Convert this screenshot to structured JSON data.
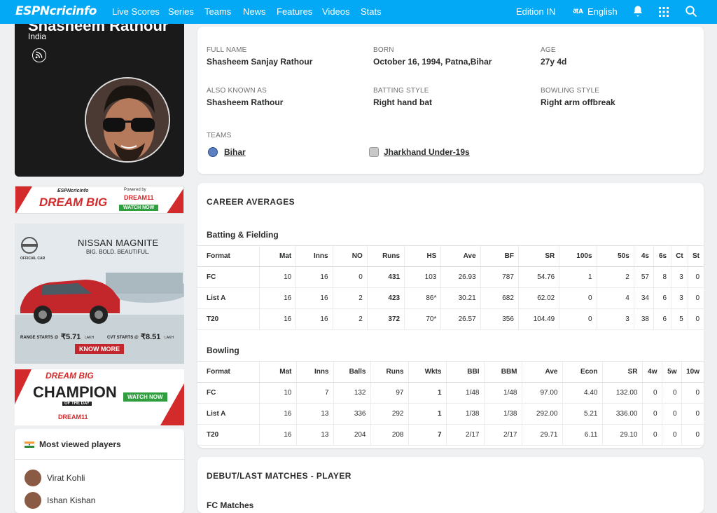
{
  "nav": {
    "logo": "ESPNcricinfo",
    "items": [
      "Live Scores",
      "Series",
      "Teams",
      "News",
      "Features",
      "Videos",
      "Stats"
    ],
    "edition": "Edition IN",
    "language": "English"
  },
  "profile": {
    "name": "Shasheem Rathour",
    "country": "India"
  },
  "info": {
    "full_name_label": "FULL NAME",
    "full_name": "Shasheem Sanjay Rathour",
    "born_label": "BORN",
    "born": "October 16, 1994, Patna,Bihar",
    "age_label": "AGE",
    "age": "27y 4d",
    "aka_label": "ALSO KNOWN AS",
    "aka": "Shasheem Rathour",
    "batting_label": "BATTING STYLE",
    "batting": "Right hand bat",
    "bowling_label": "BOWLING STYLE",
    "bowling": "Right arm offbreak",
    "teams_label": "TEAMS",
    "teams": [
      "Bihar",
      "Jharkhand Under-19s"
    ]
  },
  "career": {
    "title": "CAREER AVERAGES",
    "batting_title": "Batting & Fielding",
    "batting_headers": [
      "Format",
      "Mat",
      "Inns",
      "NO",
      "Runs",
      "HS",
      "Ave",
      "BF",
      "SR",
      "100s",
      "50s",
      "4s",
      "6s",
      "Ct",
      "St"
    ],
    "batting_rows": [
      [
        "FC",
        "10",
        "16",
        "0",
        "431",
        "103",
        "26.93",
        "787",
        "54.76",
        "1",
        "2",
        "57",
        "8",
        "3",
        "0"
      ],
      [
        "List A",
        "16",
        "16",
        "2",
        "423",
        "86*",
        "30.21",
        "682",
        "62.02",
        "0",
        "4",
        "34",
        "6",
        "3",
        "0"
      ],
      [
        "T20",
        "16",
        "16",
        "2",
        "372",
        "70*",
        "26.57",
        "356",
        "104.49",
        "0",
        "3",
        "38",
        "6",
        "5",
        "0"
      ]
    ],
    "bowling_title": "Bowling",
    "bowling_headers": [
      "Format",
      "Mat",
      "Inns",
      "Balls",
      "Runs",
      "Wkts",
      "BBI",
      "BBM",
      "Ave",
      "Econ",
      "SR",
      "4w",
      "5w",
      "10w"
    ],
    "bowling_rows": [
      [
        "FC",
        "10",
        "7",
        "132",
        "97",
        "1",
        "1/48",
        "1/48",
        "97.00",
        "4.40",
        "132.00",
        "0",
        "0",
        "0"
      ],
      [
        "List A",
        "16",
        "13",
        "336",
        "292",
        "1",
        "1/38",
        "1/38",
        "292.00",
        "5.21",
        "336.00",
        "0",
        "0",
        "0"
      ],
      [
        "T20",
        "16",
        "13",
        "204",
        "208",
        "7",
        "2/17",
        "2/17",
        "29.71",
        "6.11",
        "29.10",
        "0",
        "0",
        "0"
      ]
    ]
  },
  "debut": {
    "title": "DEBUT/LAST MATCHES - PLAYER",
    "sub": "FC Matches"
  },
  "most_viewed": {
    "title": "Most viewed players",
    "players": [
      "Virat Kohli",
      "Ishan Kishan"
    ]
  },
  "ads": {
    "dreambig_brand": "ESPNcricinfo",
    "dreambig_text": "DREAM BIG",
    "powered_by": "Powered by",
    "dream11": "DREAM11",
    "watch_now": "WATCH NOW",
    "watch_now_2": "WATCH NOW",
    "nissan_title": "NISSAN MAGNITE",
    "nissan_tag": "BIG. BOLD. BEAUTIFUL.",
    "official_car": "OFFICIAL CAR",
    "range_starts": "RANGE STARTS @",
    "range_price": "₹5.71",
    "lakh1": "LAKH",
    "cvt_starts": "CVT STARTS @",
    "cvt_price": "₹8.51",
    "lakh2": "LAKH",
    "know_more": "KNOW MORE",
    "champion_top": "DREAM BIG",
    "champion": "CHAMPION",
    "of_the_day": "OF THE DAY",
    "dream11_2": "DREAM11"
  }
}
